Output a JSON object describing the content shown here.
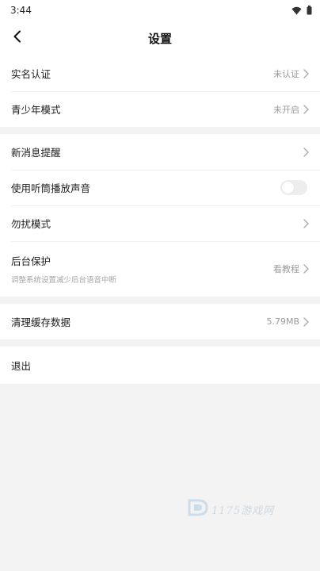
{
  "status_bar": {
    "time": "3:44"
  },
  "nav": {
    "title": "设置"
  },
  "groups": [
    {
      "items": [
        {
          "label": "实名认证",
          "value": "未认证"
        },
        {
          "label": "青少年模式",
          "value": "未开启"
        }
      ]
    },
    {
      "items": [
        {
          "label": "新消息提醒",
          "value": ""
        },
        {
          "label": "使用听筒播放声音",
          "toggle_on": false
        },
        {
          "label": "勿扰模式",
          "value": ""
        },
        {
          "label": "后台保护",
          "subtitle": "调整系统设置减少后台语音中断",
          "value": "看教程"
        }
      ]
    },
    {
      "items": [
        {
          "label": "清理缓存数据",
          "value": "5.79MB"
        }
      ]
    },
    {
      "items": [
        {
          "label": "退出"
        }
      ]
    }
  ],
  "watermark": {
    "text": "1175游戏网"
  },
  "colors": {
    "background": "#f3f3f3",
    "card": "#ffffff",
    "secondary_text": "#9a9a9a",
    "toggle_off": "#ededed"
  }
}
